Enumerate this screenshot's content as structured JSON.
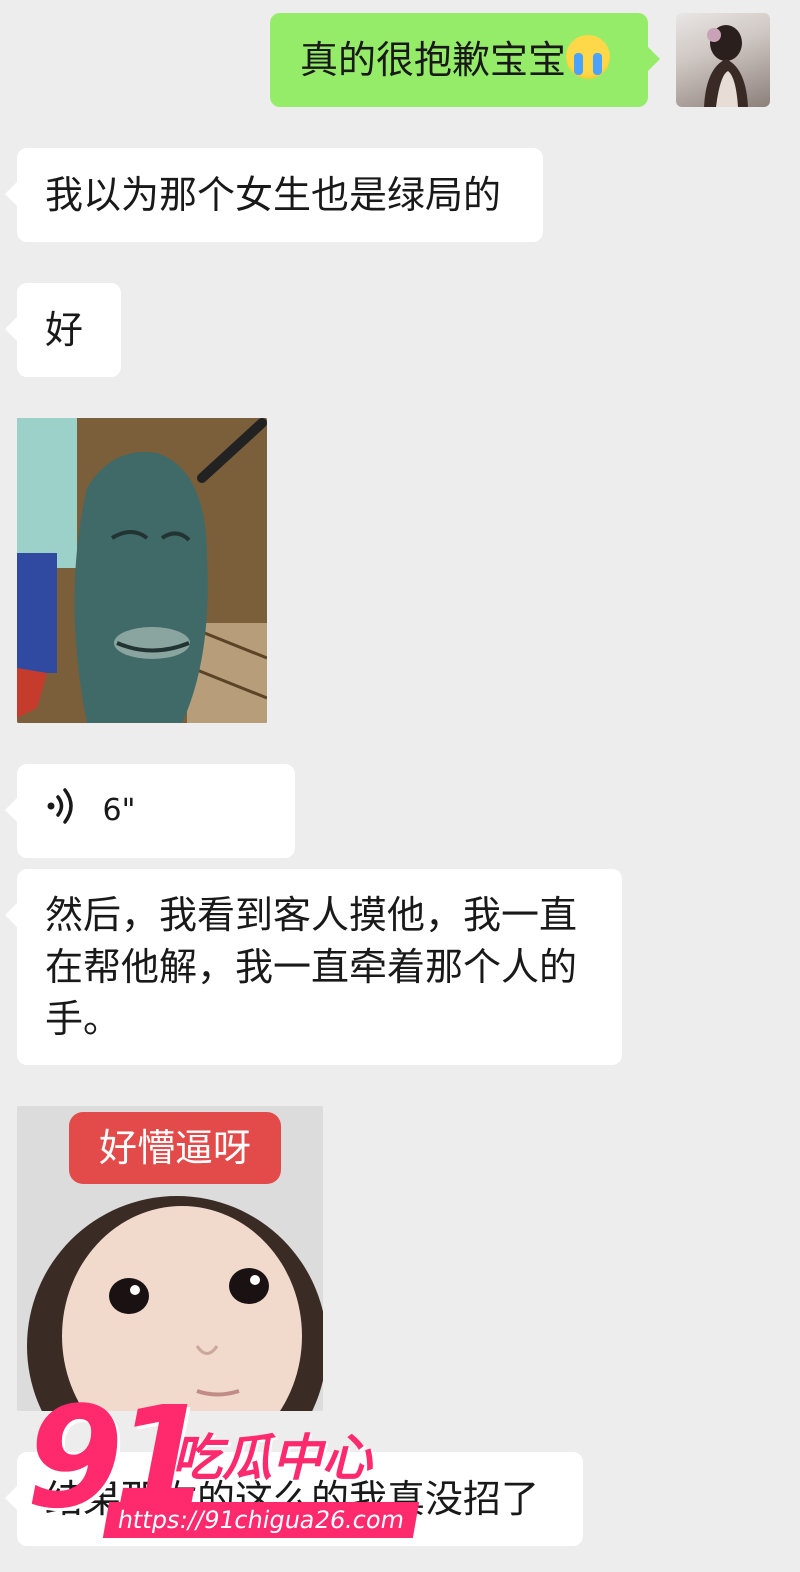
{
  "messages": [
    {
      "side": "out",
      "text": "真的很抱歉宝宝",
      "emoji": "loudly-crying-face"
    },
    {
      "side": "in",
      "text": "我以为那个女生也是绿局的"
    },
    {
      "side": "in",
      "text": "好"
    },
    {
      "side": "in",
      "type": "sticker",
      "desc": "plankton-sticker"
    },
    {
      "side": "in",
      "type": "voice",
      "duration": "6\""
    },
    {
      "side": "in",
      "text_line1": "然后，我看到客人摸他，我一直",
      "text_line2": "在帮他解，我一直牵着那个人的",
      "text_line3": "手。"
    },
    {
      "side": "in",
      "type": "sticker",
      "caption": "好懵逼呀",
      "desc": "baby-face-sticker"
    },
    {
      "side": "in",
      "text": "结果那你的这么的我真没招了"
    }
  ],
  "watermark": {
    "number": "91",
    "title": "吃瓜中心",
    "url": "https://91chigua26.com"
  },
  "colors": {
    "background": "#ededed",
    "bubble_out": "#95ec69",
    "bubble_in": "#ffffff",
    "watermark_pink": "#ff2a6d"
  }
}
